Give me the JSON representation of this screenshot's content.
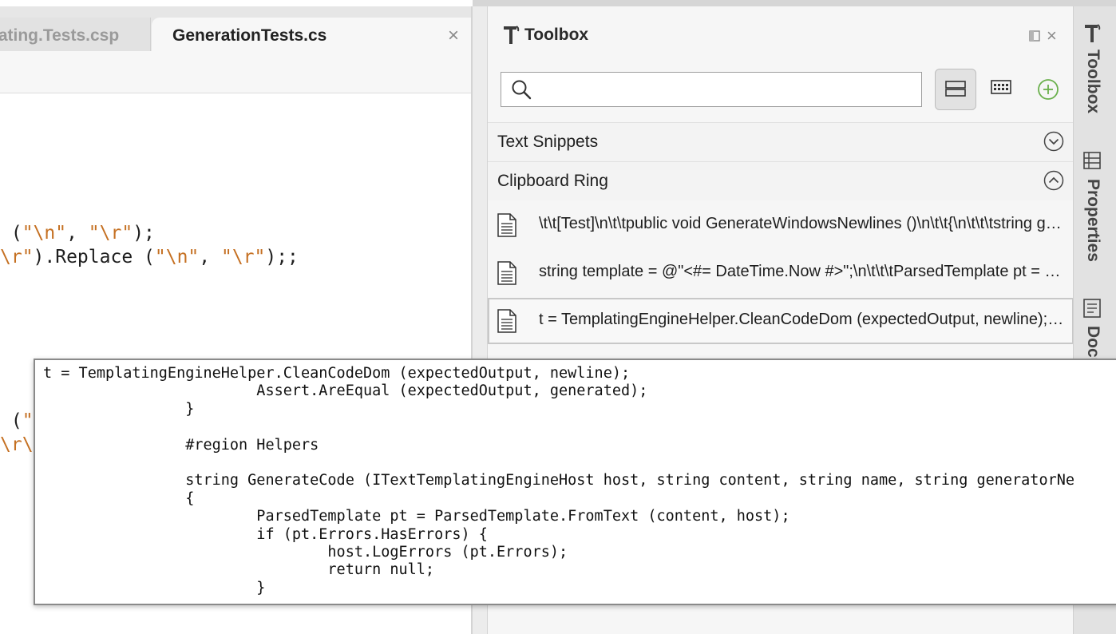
{
  "editor": {
    "tabs": [
      {
        "label": "lating.Tests.csp",
        "active": false
      },
      {
        "label": "GenerationTests.cs",
        "active": true
      }
    ],
    "close_glyph": "×",
    "code_lines": [
      [
        {
          "t": " (",
          "k": "p"
        },
        {
          "t": "\"\\n\"",
          "k": "s"
        },
        {
          "t": ", ",
          "k": "p"
        },
        {
          "t": "\"\\r\"",
          "k": "s"
        },
        {
          "t": ");",
          "k": "p"
        }
      ],
      [
        {
          "t": "\\r\"",
          "k": "s"
        },
        {
          "t": ").Replace (",
          "k": "p"
        },
        {
          "t": "\"\\n\"",
          "k": "s"
        },
        {
          "t": ", ",
          "k": "p"
        },
        {
          "t": "\"\\r\"",
          "k": "s"
        },
        {
          "t": ");;",
          "k": "p"
        }
      ],
      [
        {
          "t": " (",
          "k": "p"
        },
        {
          "t": "\"",
          "k": "s"
        }
      ],
      [
        {
          "t": "\\r\\",
          "k": "s"
        }
      ]
    ]
  },
  "toolbox": {
    "title": "Toolbox",
    "search": {
      "placeholder": "",
      "value": ""
    },
    "categories": [
      {
        "label": "Text Snippets",
        "expanded": false
      },
      {
        "label": "Clipboard Ring",
        "expanded": true
      }
    ],
    "clipboard_items": [
      "\\t\\t[Test]\\n\\t\\tpublic void GenerateWindowsNewlines ()\\n\\t\\t{\\n\\t\\t\\tstring generated = GenerationTests.Generate ()",
      "string template = @\"<#= DateTime.Now #>\";\\n\\t\\t\\tParsedTemplate pt = ParsedTemplate.FromText (template, host)",
      "t = TemplatingEngineHelper.CleanCodeDom (expectedOutput, newline);\\n\\t\\t\\tAssert.AreEqual (expectedOutput, generated)"
    ],
    "selected_item": 2
  },
  "side_pads": [
    {
      "label": "Toolbox",
      "icon": "hammer-icon"
    },
    {
      "label": "Properties",
      "icon": "properties-icon"
    },
    {
      "label": "Document Outline",
      "icon": "document-outline-icon"
    }
  ],
  "tooltip": {
    "lines": [
      "t = TemplatingEngineHelper.CleanCodeDom (expectedOutput, newline);",
      "                        Assert.AreEqual (expectedOutput, generated);",
      "                }",
      "",
      "                #region Helpers",
      "",
      "                string GenerateCode (ITextTemplatingEngineHost host, string content, string name, string generatorNe",
      "                {",
      "                        ParsedTemplate pt = ParsedTemplate.FromText (content, host);",
      "                        if (pt.Errors.HasErrors) {",
      "                                host.LogErrors (pt.Errors);",
      "                                return null;",
      "                        }"
    ]
  },
  "colors": {
    "string": "#c57022",
    "add_icon": "#6ab04c"
  }
}
